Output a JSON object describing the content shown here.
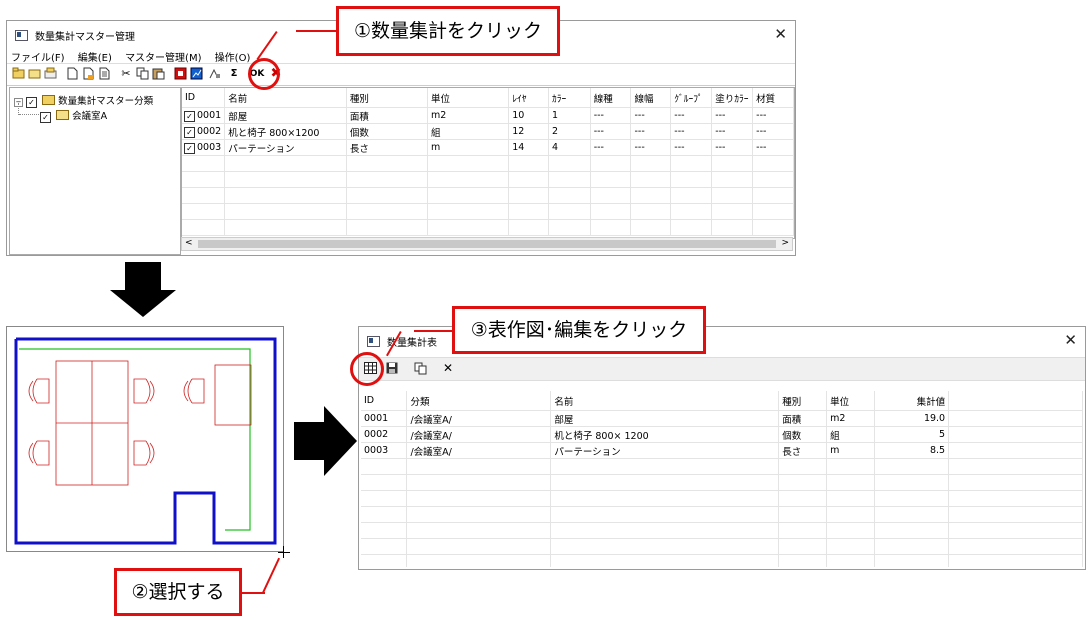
{
  "callouts": {
    "step1": "①数量集計をクリック",
    "step2": "②選択する",
    "step3": "③表作図･編集をクリック"
  },
  "master_window": {
    "title": "数量集計マスター管理",
    "close_icon": "close-icon",
    "menu": [
      "ファイル(F)",
      "編集(E)",
      "マスター管理(M)",
      "操作(O)"
    ],
    "toolbar_ok": "OK",
    "tree": {
      "root": "数量集計マスター分類",
      "child": "会議室A"
    },
    "columns": [
      "ID",
      "名前",
      "種別",
      "単位",
      "ﾚｲﾔ",
      "ｶﾗｰ",
      "線種",
      "線幅",
      "ｸﾞﾙｰﾌﾟ",
      "塗りｶﾗｰ",
      "材質"
    ],
    "rows": [
      {
        "id": "0001",
        "name": "部屋",
        "kind": "面積",
        "unit": "m2",
        "layer": "10",
        "color": "1",
        "ltype": "---",
        "lwidth": "---",
        "group": "---",
        "fill": "---",
        "material": "---"
      },
      {
        "id": "0002",
        "name": "机と椅子 800×1200",
        "kind": "個数",
        "unit": "組",
        "layer": "12",
        "color": "2",
        "ltype": "---",
        "lwidth": "---",
        "group": "---",
        "fill": "---",
        "material": "---"
      },
      {
        "id": "0003",
        "name": "パーテーション",
        "kind": "長さ",
        "unit": "m",
        "layer": "14",
        "color": "4",
        "ltype": "---",
        "lwidth": "---",
        "group": "---",
        "fill": "---",
        "material": "---"
      }
    ]
  },
  "result_window": {
    "title": "数量集計表",
    "columns": [
      "ID",
      "分類",
      "名前",
      "種別",
      "単位",
      "集計値"
    ],
    "rows": [
      {
        "id": "0001",
        "category": "/会議室A/",
        "name": "部屋",
        "kind": "面積",
        "unit": "m2",
        "value": "19.0"
      },
      {
        "id": "0002",
        "category": "/会議室A/",
        "name": "机と椅子 800× 1200",
        "kind": "個数",
        "unit": "組",
        "value": "5"
      },
      {
        "id": "0003",
        "category": "/会議室A/",
        "name": "パーテーション",
        "kind": "長さ",
        "unit": "m",
        "value": "8.5"
      }
    ]
  },
  "colors": {
    "accent_red": "#e01010",
    "wall_blue": "#1010c8",
    "furniture_red": "#d02020",
    "partition_green": "#20c020"
  }
}
